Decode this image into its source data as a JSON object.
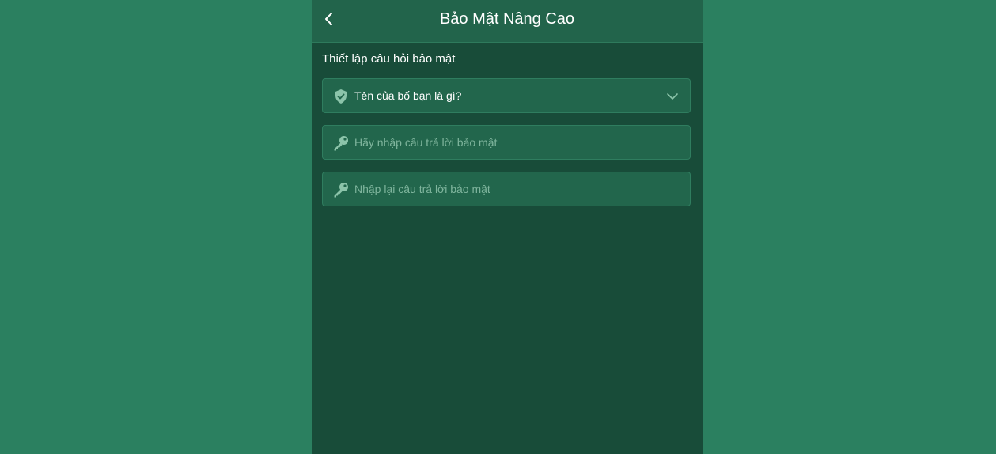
{
  "header": {
    "title": "Bảo Mật Nâng Cao",
    "back_icon": "chevron-left-icon"
  },
  "section": {
    "label": "Thiết lập câu hỏi bảo mật"
  },
  "question_select": {
    "icon": "shield-check-icon",
    "selected_value": "Tên của bố bạn là gì?",
    "dropdown_icon": "chevron-down-icon"
  },
  "answer_input": {
    "icon": "key-icon",
    "placeholder": "Hãy nhập câu trả lời bảo mật"
  },
  "confirm_input": {
    "icon": "key-icon",
    "placeholder": "Nhập lại câu trả lời bảo mật"
  },
  "colors": {
    "page_background": "#2b8060",
    "panel_background": "#184c39",
    "header_background": "#22644b",
    "field_background": "#22664c",
    "placeholder_text": "#7fb59d",
    "icon_color": "#8cc4aa"
  }
}
